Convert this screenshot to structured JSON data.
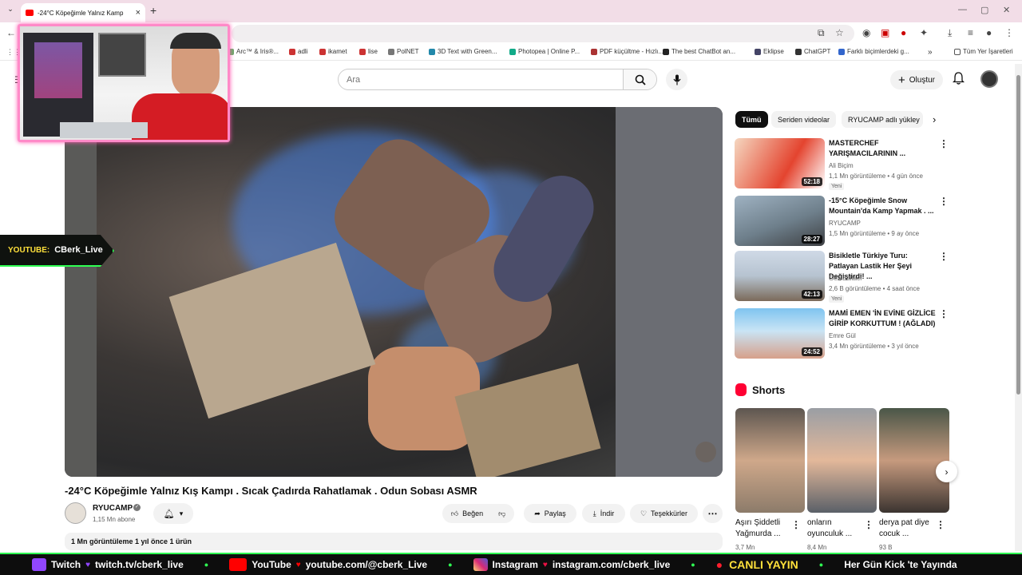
{
  "browser": {
    "tab_title": "-24°C Köpeğimle Yalnız Kamp",
    "tab_close": "×",
    "new_tab": "+",
    "bookmarks": [
      "Arc™ & Iris®...",
      "adli",
      "ikamet",
      "lise",
      "PolNET",
      "3D Text with Green...",
      "Photopea | Online P...",
      "PDF küçültme - Hızlı...",
      "The best ChatBot an...",
      "Eklipse",
      "ChatGPT",
      "Farklı biçimlerdeki g...",
      "»",
      "Tüm Yer İşaretleri"
    ]
  },
  "header": {
    "search_placeholder": "Ara",
    "create_label": "Oluştur"
  },
  "stream": {
    "platform_label": "YOUTUBE:",
    "channel": "CBerk_Live"
  },
  "video": {
    "title": "-24°C Köpeğimle Yalnız Kış Kampı . Sıcak Çadırda Rahatlamak . Odun Sobası ASMR",
    "channel_name": "RYUCAMP",
    "subscribers": "1,15 Mn abone",
    "actions": {
      "like": "Beğen",
      "share": "Paylaş",
      "download": "İndir",
      "thanks": "Teşekkürler"
    },
    "description_meta": "1 Mn görüntüleme  1 yıl önce  1 ürün"
  },
  "sidebar": {
    "chips": [
      "Tümü",
      "Seriden videolar",
      "RYUCAMP adlı yükley"
    ],
    "recommendations": [
      {
        "title": "MASTERCHEF YARIŞMACILARININ ...",
        "channel": "Ali Biçim",
        "meta": "1,1 Mn görüntüleme • 4 gün önce",
        "badge": "Yeni",
        "duration": "52:18"
      },
      {
        "title": "-15°C Köpeğimle Snow Mountain'da Kamp Yapmak . ...",
        "channel": "RYUCAMP",
        "meta": "1,5 Mn görüntüleme • 9 ay önce",
        "badge": "",
        "duration": "28:27"
      },
      {
        "title": "Bisikletle Türkiye Turu: Patlayan Lastik Her Şeyi Değiştirdi! ...",
        "channel": "Gez Baltacı",
        "meta": "2,6 B görüntüleme • 4 saat önce",
        "badge": "Yeni",
        "duration": "42:13"
      },
      {
        "title": "MAMİ EMEN 'İN EVİNE GİZLİCE GİRİP KORKUTTUM ! (AĞLADI)",
        "channel": "Emre Gül",
        "meta": "3,4 Mn görüntüleme • 3 yıl önce",
        "badge": "",
        "duration": "24:52"
      }
    ],
    "shorts_title": "Shorts",
    "shorts": [
      {
        "title": "Aşırı Şiddetli Yağmurda ...",
        "views": "3,7 Mn"
      },
      {
        "title": "onların oyunculuk ...",
        "views": "8,4 Mn"
      },
      {
        "title": "derya pat diye cocuk ...",
        "views": "93 B"
      }
    ]
  },
  "ticker": {
    "twitch_label": "Twitch",
    "twitch_url": "twitch.tv/cberk_live",
    "youtube_label": "YouTube",
    "youtube_url": "youtube.com/@cberk_Live",
    "instagram_label": "Instagram",
    "instagram_url": "instagram.com/cberk_live",
    "live_label": "CANLI YAYIN",
    "promo": "Her Gün Kick 'te Yayında"
  },
  "colors": {
    "accent_green": "#2fff53",
    "webcam_border": "#ff8ac8",
    "youtube_red": "#ff0000",
    "twitch_purple": "#9146ff"
  }
}
